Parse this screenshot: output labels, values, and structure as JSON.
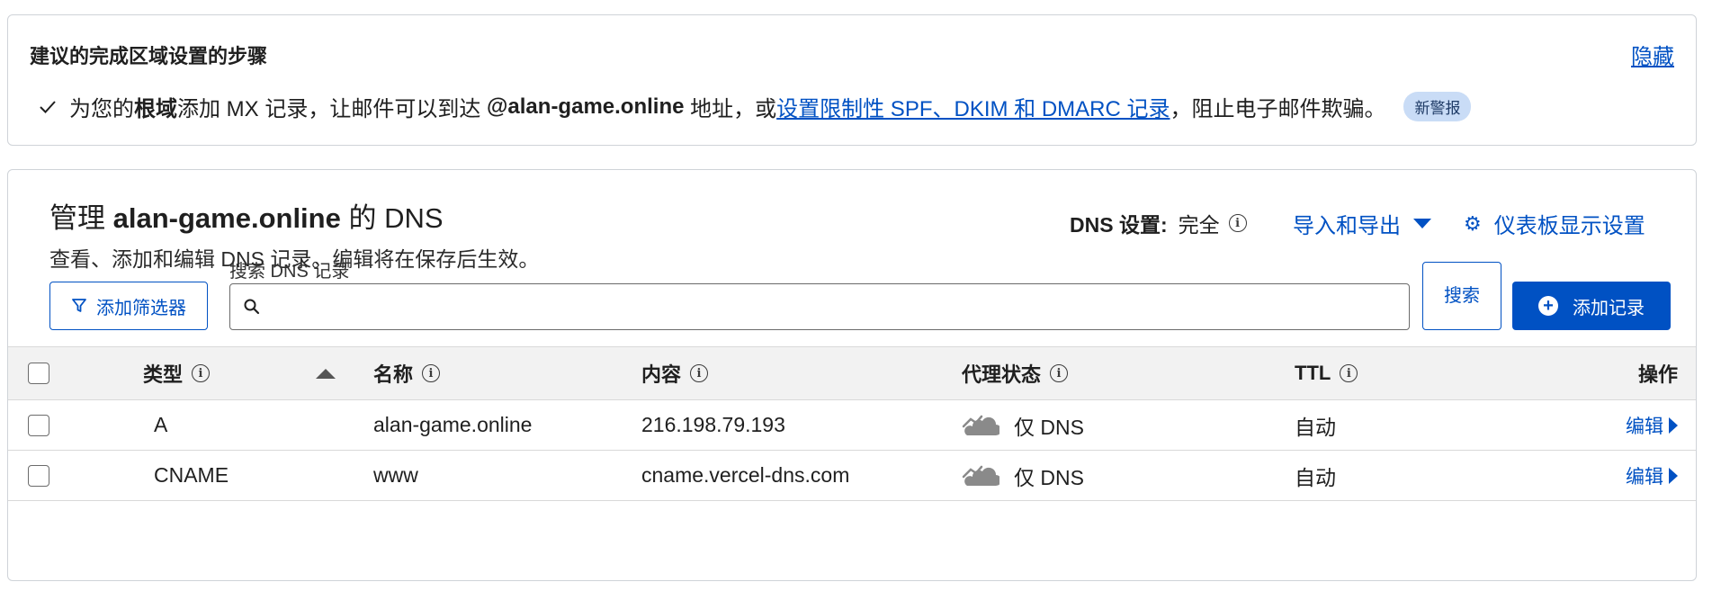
{
  "steps": {
    "title": "建议的完成区域设置的步骤",
    "hide_label": "隐藏",
    "item": {
      "text_1": "为您的",
      "bold_1": "根域",
      "text_2": "添加 MX 记录，让邮件可以到达 ",
      "bold_2": "@alan-game.online",
      "text_3": " 地址，或",
      "link": "设置限制性 SPF、DKIM 和 DMARC 记录",
      "text_4": "，阻止电子邮件欺骗。",
      "badge": "新警报"
    }
  },
  "dns": {
    "title_prefix": "管理 ",
    "title_domain": "alan-game.online",
    "title_suffix": " 的 DNS",
    "subtitle": "查看、添加和编辑 DNS 记录。编辑将在保存后生效。",
    "setting_label": "DNS 设置:",
    "setting_value": "完全",
    "import_export_label": "导入和导出",
    "dashboard_settings_label": "仪表板显示设置",
    "filter_button": "添加筛选器",
    "search_label": "搜索 DNS 记录",
    "search_value": "",
    "search_button": "搜索",
    "add_button": "添加记录"
  },
  "table": {
    "headers": {
      "type": "类型",
      "name": "名称",
      "content": "内容",
      "proxy": "代理状态",
      "ttl": "TTL",
      "actions": "操作"
    },
    "rows": [
      {
        "type": "A",
        "name": "alan-game.online",
        "content": "216.198.79.193",
        "proxy": "仅 DNS",
        "ttl": "自动",
        "action": "编辑"
      },
      {
        "type": "CNAME",
        "name": "www",
        "content": "cname.vercel-dns.com",
        "proxy": "仅 DNS",
        "ttl": "自动",
        "action": "编辑"
      }
    ]
  },
  "colors": {
    "accent": "#0051c3",
    "badge_bg": "#c9dcf6",
    "header_bg": "#f2f2f2"
  }
}
